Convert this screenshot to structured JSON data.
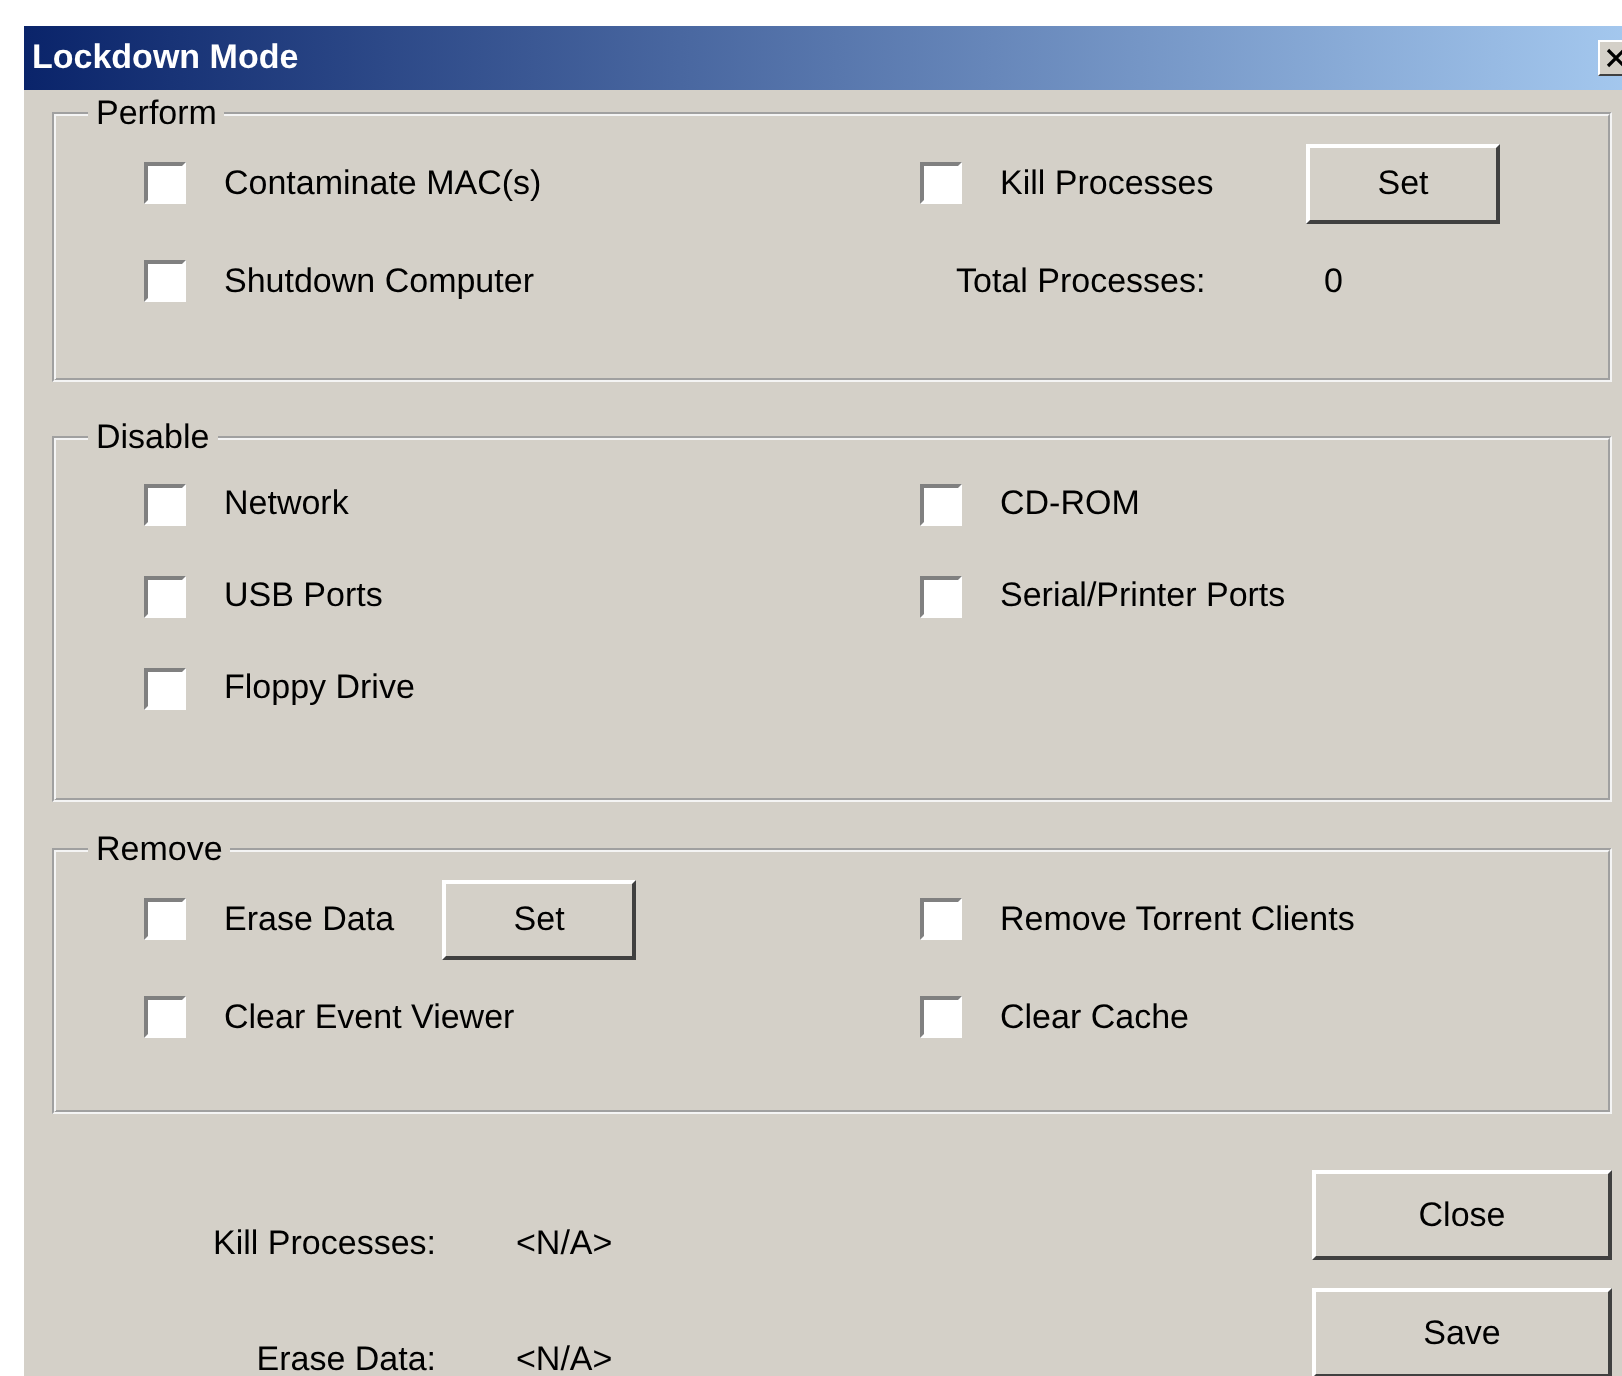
{
  "window": {
    "title": "Lockdown Mode"
  },
  "groups": [
    {
      "title": "Perform",
      "left_column": [
        {
          "kind": "checkbox",
          "label": "Contaminate MAC(s)",
          "checked": false
        },
        {
          "kind": "checkbox",
          "label": "Shutdown Computer",
          "checked": false
        }
      ],
      "right_column": [
        {
          "kind": "checkbox",
          "label": "Kill Processes",
          "checked": false,
          "button": "Set"
        },
        {
          "kind": "info",
          "label": "Total Processes:",
          "value": "0"
        }
      ]
    },
    {
      "title": "Disable",
      "left_column": [
        {
          "kind": "checkbox",
          "label": "Network",
          "checked": false
        },
        {
          "kind": "checkbox",
          "label": "USB Ports",
          "checked": false
        },
        {
          "kind": "checkbox",
          "label": "Floppy Drive",
          "checked": false
        }
      ],
      "right_column": [
        {
          "kind": "checkbox",
          "label": "CD-ROM",
          "checked": false
        },
        {
          "kind": "checkbox",
          "label": "Serial/Printer Ports",
          "checked": false
        }
      ]
    },
    {
      "title": "Remove",
      "left_column": [
        {
          "kind": "checkbox",
          "label": "Erase Data",
          "checked": false,
          "button": "Set"
        },
        {
          "kind": "checkbox",
          "label": "Clear Event Viewer",
          "checked": false
        }
      ],
      "right_column": [
        {
          "kind": "checkbox",
          "label": "Remove Torrent Clients",
          "checked": false
        },
        {
          "kind": "checkbox",
          "label": "Clear Cache",
          "checked": false
        }
      ]
    }
  ],
  "status": [
    {
      "label": "Kill Processes:",
      "value": "<N/A>"
    },
    {
      "label": "Erase Data:",
      "value": "<N/A>"
    }
  ],
  "buttons": [
    "Close",
    "Save"
  ]
}
